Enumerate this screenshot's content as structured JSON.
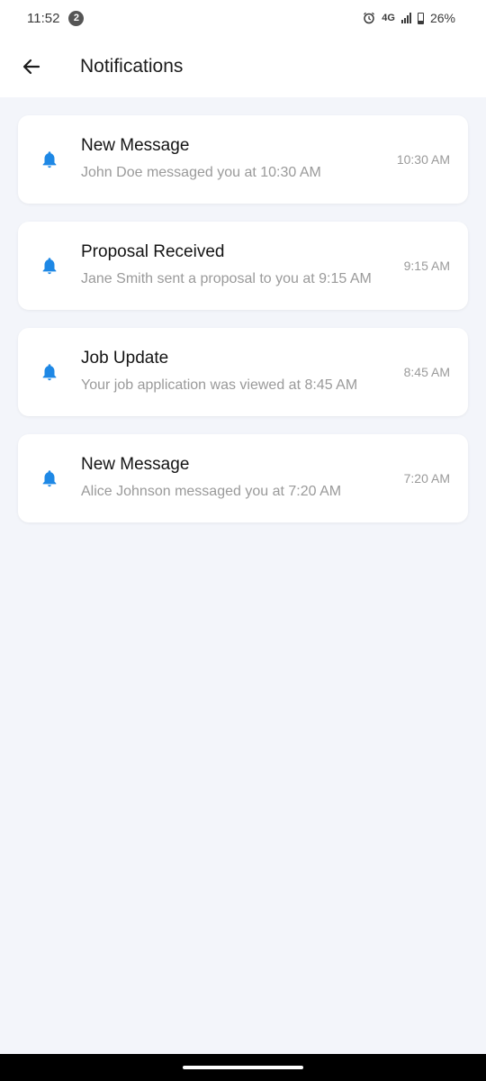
{
  "status_bar": {
    "time": "11:52",
    "notification_count": "2",
    "network": "4G",
    "battery": "26%",
    "battery_level": 0.26
  },
  "header": {
    "title": "Notifications"
  },
  "accent_color": "#1e88e5",
  "notifications": [
    {
      "title": "New Message",
      "body": "John Doe messaged you at 10:30 AM",
      "time": "10:30 AM"
    },
    {
      "title": "Proposal Received",
      "body": "Jane Smith sent a proposal to you at 9:15 AM",
      "time": "9:15 AM"
    },
    {
      "title": "Job Update",
      "body": "Your job application was viewed at 8:45 AM",
      "time": "8:45 AM"
    },
    {
      "title": "New Message",
      "body": "Alice Johnson messaged you at 7:20 AM",
      "time": "7:20 AM"
    }
  ]
}
